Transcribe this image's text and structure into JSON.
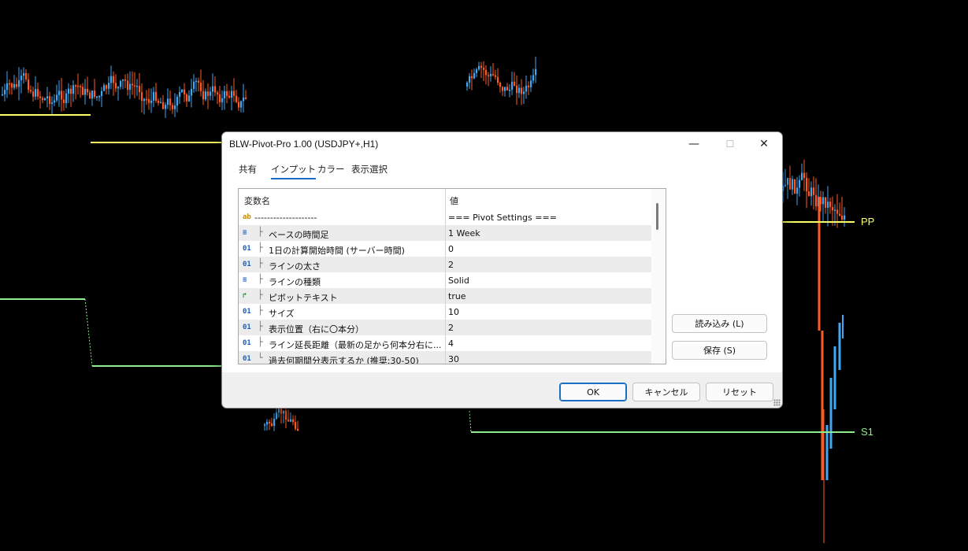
{
  "chart": {
    "pivot_label": "PP",
    "pivot_color": "#ffff66",
    "s1_label": "S1",
    "s1_color": "#90ee90",
    "bull_color": "#3fa9f5",
    "bear_color": "#ff5a1f"
  },
  "dialog": {
    "title": "BLW-Pivot-Pro 1.00 (USDJPY+,H1)",
    "tabs": [
      "共有",
      "インプット",
      "カラー",
      "表示選択"
    ],
    "active_tab": "インプット",
    "columns": {
      "name": "変数名",
      "value": "値"
    },
    "rows": [
      {
        "icon": "ab",
        "icon_name": "string-type-icon",
        "tree": "",
        "name": "--------------------",
        "value": "=== Pivot Settings ==="
      },
      {
        "icon": "≡",
        "icon_name": "enum-type-icon",
        "tree": "├",
        "name": "ベースの時間足",
        "value": "1 Week"
      },
      {
        "icon": "01",
        "icon_name": "integer-type-icon",
        "tree": "├",
        "name": "1日の計算開始時間 (サーバー時間)",
        "value": "0"
      },
      {
        "icon": "01",
        "icon_name": "integer-type-icon",
        "tree": "├",
        "name": "ラインの太さ",
        "value": "2"
      },
      {
        "icon": "≡",
        "icon_name": "enum-type-icon",
        "tree": "├",
        "name": "ラインの種類",
        "value": "Solid"
      },
      {
        "icon": "↱",
        "icon_name": "bool-type-icon",
        "tree": "├",
        "name": "ピボットテキスト",
        "value": "true"
      },
      {
        "icon": "01",
        "icon_name": "integer-type-icon",
        "tree": "├",
        "name": "サイズ",
        "value": "10"
      },
      {
        "icon": "01",
        "icon_name": "integer-type-icon",
        "tree": "├",
        "name": "表示位置（右に〇本分）",
        "value": "2"
      },
      {
        "icon": "01",
        "icon_name": "integer-type-icon",
        "tree": "├",
        "name": "ライン延長距離（最新の足から何本分右に...",
        "value": "4"
      },
      {
        "icon": "01",
        "icon_name": "integer-type-icon",
        "tree": "└",
        "name": "過去何期間分表示するか (推奨:30-50)",
        "value": "30"
      }
    ],
    "buttons": {
      "load": "読み込み (L)",
      "save": "保存 (S)",
      "ok": "OK",
      "cancel": "キャンセル",
      "reset": "リセット"
    },
    "window_controls": {
      "minimize": "—",
      "maximize": "☐",
      "close": "✕"
    }
  }
}
